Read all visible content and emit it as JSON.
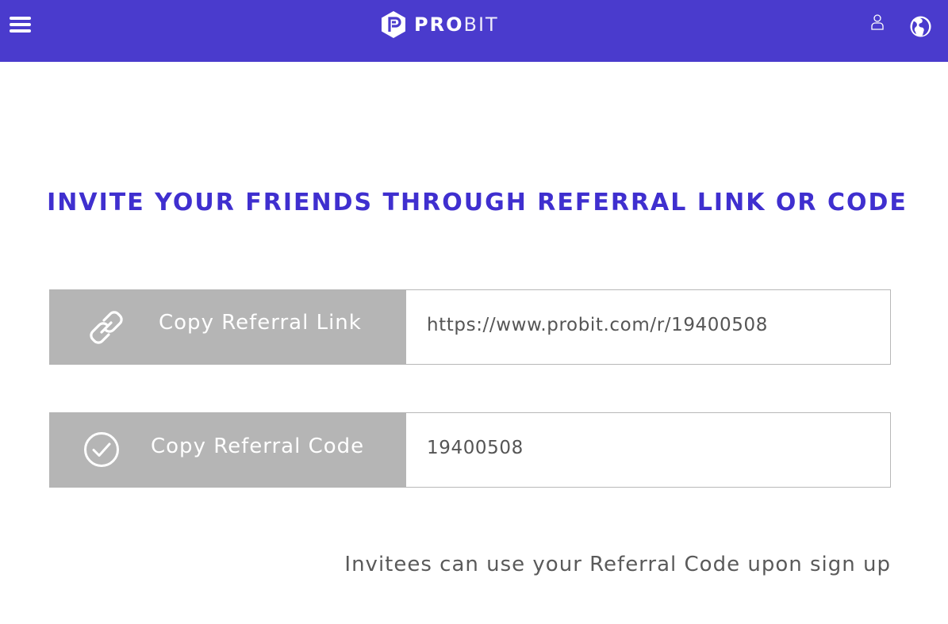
{
  "header": {
    "menu_icon": "hamburger-menu-icon",
    "logo_bold": "PRO",
    "logo_light": "BIT",
    "user_icon": "user-icon",
    "globe_icon": "globe-icon",
    "bg_color": "#4a3bcd"
  },
  "main": {
    "headline": "INVITE YOUR FRIENDS THROUGH REFERRAL LINK OR CODE",
    "headline_color": "#3f2fcf",
    "referral_link": {
      "button_label": "Copy Referral Link",
      "icon": "link-chain-icon",
      "value": "https://www.probit.com/r/19400508"
    },
    "referral_code": {
      "button_label": "Copy Referral Code",
      "icon": "check-circle-icon",
      "value": "19400508"
    },
    "note": "Invitees can use your Referral Code upon sign up"
  }
}
